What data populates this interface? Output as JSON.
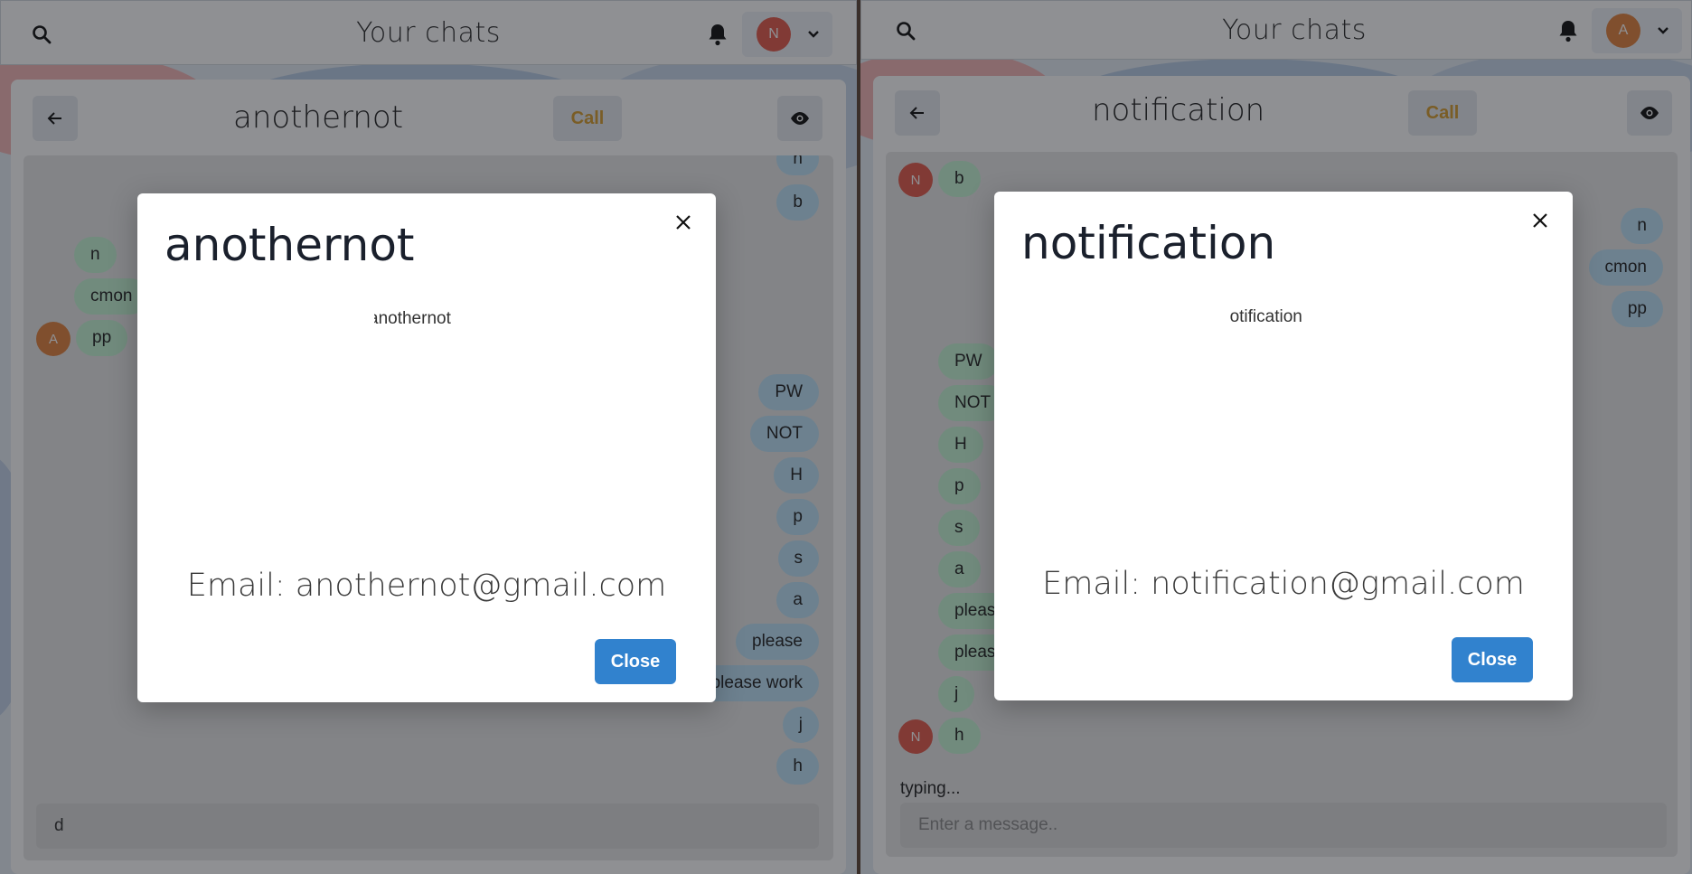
{
  "left": {
    "topbar": {
      "title": "Your chats",
      "avatar_initial": "N",
      "avatar_color": "#e45a4c"
    },
    "chat": {
      "name": "anothernot",
      "call_label": "Call",
      "input_value": "d",
      "messages_green": [
        "n",
        "cmon",
        "pp"
      ],
      "messages_blue": [
        "n",
        "b",
        "PW",
        "NOT",
        "H",
        "p",
        "s",
        "a",
        "please",
        "please work",
        "j",
        "h"
      ],
      "sender_initial": "A"
    },
    "modal": {
      "title": "anothernot",
      "image_alt": "anothernot",
      "email": "Email: anothernot@gmail.com",
      "close_label": "Close"
    }
  },
  "right": {
    "topbar": {
      "title": "Your chats",
      "avatar_initial": "A",
      "avatar_color": "#e3833f"
    },
    "chat": {
      "name": "notification",
      "call_label": "Call",
      "input_placeholder": "Enter a message..",
      "typing_text": "typing...",
      "messages_green": [
        "b",
        "PW",
        "NOT",
        "H",
        "p",
        "s",
        "a",
        "pleas",
        "pleas",
        "j",
        "h"
      ],
      "messages_blue": [
        "n",
        "cmon",
        "pp"
      ],
      "sender_initial": "N"
    },
    "modal": {
      "title": "notification",
      "image_alt": "notification",
      "email": "Email: notification@gmail.com",
      "close_label": "Close"
    }
  },
  "colors": {
    "accent": "#3182ce",
    "call": "#d69e2e",
    "bubble_green": "#c6f6d5",
    "bubble_blue": "#bee3f8"
  }
}
